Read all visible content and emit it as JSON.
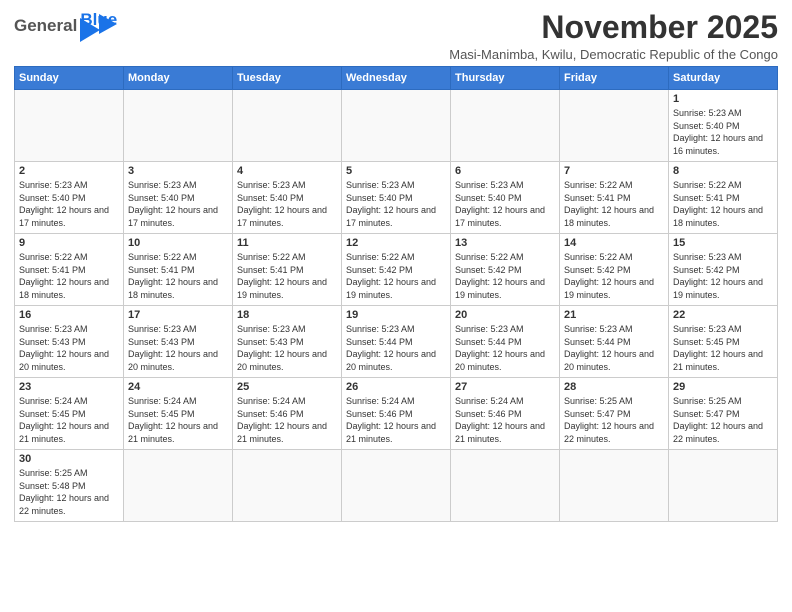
{
  "header": {
    "logo": "General Blue",
    "month_title": "November 2025",
    "subtitle": "Masi-Manimba, Kwilu, Democratic Republic of the Congo"
  },
  "weekdays": [
    "Sunday",
    "Monday",
    "Tuesday",
    "Wednesday",
    "Thursday",
    "Friday",
    "Saturday"
  ],
  "weeks": [
    [
      {
        "day": "",
        "info": ""
      },
      {
        "day": "",
        "info": ""
      },
      {
        "day": "",
        "info": ""
      },
      {
        "day": "",
        "info": ""
      },
      {
        "day": "",
        "info": ""
      },
      {
        "day": "",
        "info": ""
      },
      {
        "day": "1",
        "info": "Sunrise: 5:23 AM\nSunset: 5:40 PM\nDaylight: 12 hours and 16 minutes."
      }
    ],
    [
      {
        "day": "2",
        "info": "Sunrise: 5:23 AM\nSunset: 5:40 PM\nDaylight: 12 hours and 17 minutes."
      },
      {
        "day": "3",
        "info": "Sunrise: 5:23 AM\nSunset: 5:40 PM\nDaylight: 12 hours and 17 minutes."
      },
      {
        "day": "4",
        "info": "Sunrise: 5:23 AM\nSunset: 5:40 PM\nDaylight: 12 hours and 17 minutes."
      },
      {
        "day": "5",
        "info": "Sunrise: 5:23 AM\nSunset: 5:40 PM\nDaylight: 12 hours and 17 minutes."
      },
      {
        "day": "6",
        "info": "Sunrise: 5:23 AM\nSunset: 5:40 PM\nDaylight: 12 hours and 17 minutes."
      },
      {
        "day": "7",
        "info": "Sunrise: 5:22 AM\nSunset: 5:41 PM\nDaylight: 12 hours and 18 minutes."
      },
      {
        "day": "8",
        "info": "Sunrise: 5:22 AM\nSunset: 5:41 PM\nDaylight: 12 hours and 18 minutes."
      }
    ],
    [
      {
        "day": "9",
        "info": "Sunrise: 5:22 AM\nSunset: 5:41 PM\nDaylight: 12 hours and 18 minutes."
      },
      {
        "day": "10",
        "info": "Sunrise: 5:22 AM\nSunset: 5:41 PM\nDaylight: 12 hours and 18 minutes."
      },
      {
        "day": "11",
        "info": "Sunrise: 5:22 AM\nSunset: 5:41 PM\nDaylight: 12 hours and 19 minutes."
      },
      {
        "day": "12",
        "info": "Sunrise: 5:22 AM\nSunset: 5:42 PM\nDaylight: 12 hours and 19 minutes."
      },
      {
        "day": "13",
        "info": "Sunrise: 5:22 AM\nSunset: 5:42 PM\nDaylight: 12 hours and 19 minutes."
      },
      {
        "day": "14",
        "info": "Sunrise: 5:22 AM\nSunset: 5:42 PM\nDaylight: 12 hours and 19 minutes."
      },
      {
        "day": "15",
        "info": "Sunrise: 5:23 AM\nSunset: 5:42 PM\nDaylight: 12 hours and 19 minutes."
      }
    ],
    [
      {
        "day": "16",
        "info": "Sunrise: 5:23 AM\nSunset: 5:43 PM\nDaylight: 12 hours and 20 minutes."
      },
      {
        "day": "17",
        "info": "Sunrise: 5:23 AM\nSunset: 5:43 PM\nDaylight: 12 hours and 20 minutes."
      },
      {
        "day": "18",
        "info": "Sunrise: 5:23 AM\nSunset: 5:43 PM\nDaylight: 12 hours and 20 minutes."
      },
      {
        "day": "19",
        "info": "Sunrise: 5:23 AM\nSunset: 5:44 PM\nDaylight: 12 hours and 20 minutes."
      },
      {
        "day": "20",
        "info": "Sunrise: 5:23 AM\nSunset: 5:44 PM\nDaylight: 12 hours and 20 minutes."
      },
      {
        "day": "21",
        "info": "Sunrise: 5:23 AM\nSunset: 5:44 PM\nDaylight: 12 hours and 20 minutes."
      },
      {
        "day": "22",
        "info": "Sunrise: 5:23 AM\nSunset: 5:45 PM\nDaylight: 12 hours and 21 minutes."
      }
    ],
    [
      {
        "day": "23",
        "info": "Sunrise: 5:24 AM\nSunset: 5:45 PM\nDaylight: 12 hours and 21 minutes."
      },
      {
        "day": "24",
        "info": "Sunrise: 5:24 AM\nSunset: 5:45 PM\nDaylight: 12 hours and 21 minutes."
      },
      {
        "day": "25",
        "info": "Sunrise: 5:24 AM\nSunset: 5:46 PM\nDaylight: 12 hours and 21 minutes."
      },
      {
        "day": "26",
        "info": "Sunrise: 5:24 AM\nSunset: 5:46 PM\nDaylight: 12 hours and 21 minutes."
      },
      {
        "day": "27",
        "info": "Sunrise: 5:24 AM\nSunset: 5:46 PM\nDaylight: 12 hours and 21 minutes."
      },
      {
        "day": "28",
        "info": "Sunrise: 5:25 AM\nSunset: 5:47 PM\nDaylight: 12 hours and 22 minutes."
      },
      {
        "day": "29",
        "info": "Sunrise: 5:25 AM\nSunset: 5:47 PM\nDaylight: 12 hours and 22 minutes."
      }
    ],
    [
      {
        "day": "30",
        "info": "Sunrise: 5:25 AM\nSunset: 5:48 PM\nDaylight: 12 hours and 22 minutes."
      },
      {
        "day": "",
        "info": ""
      },
      {
        "day": "",
        "info": ""
      },
      {
        "day": "",
        "info": ""
      },
      {
        "day": "",
        "info": ""
      },
      {
        "day": "",
        "info": ""
      },
      {
        "day": "",
        "info": ""
      }
    ]
  ]
}
